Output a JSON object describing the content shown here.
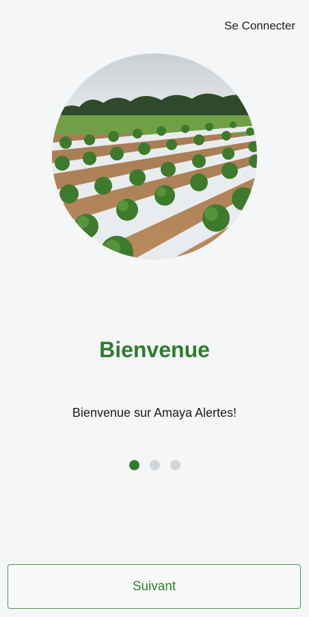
{
  "header": {
    "login_label": "Se Connecter"
  },
  "hero": {
    "image": "hemp-field-photo"
  },
  "content": {
    "title": "Bienvenue",
    "subtitle": "Bienvenue sur Amaya Alertes!"
  },
  "pager": {
    "count": 3,
    "active_index": 0
  },
  "footer": {
    "next_label": "Suivant"
  },
  "colors": {
    "accent": "#2d7d2d",
    "background": "#f4f6f8",
    "inactive_dot": "#d3d6d9"
  }
}
